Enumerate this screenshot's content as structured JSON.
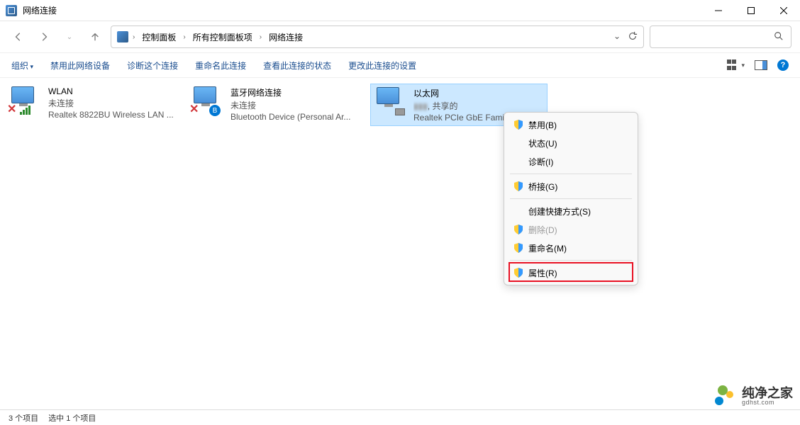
{
  "window": {
    "title": "网络连接"
  },
  "breadcrumb": {
    "root": "控制面板",
    "mid": "所有控制面板项",
    "leaf": "网络连接"
  },
  "toolbar": {
    "organize": "组织",
    "disable": "禁用此网络设备",
    "diagnose": "诊断这个连接",
    "rename": "重命名此连接",
    "status": "查看此连接的状态",
    "settings": "更改此连接的设置"
  },
  "connections": [
    {
      "name": "WLAN",
      "status": "未连接",
      "device": "Realtek 8822BU Wireless LAN ..."
    },
    {
      "name": "蓝牙网络连接",
      "status": "未连接",
      "device": "Bluetooth Device (Personal Ar..."
    },
    {
      "name": "以太网",
      "status_extra": ", 共享的",
      "device": "Realtek PCIe GbE Famil..."
    }
  ],
  "context_menu": {
    "disable": "禁用(B)",
    "status": "状态(U)",
    "diagnose": "诊断(I)",
    "bridge": "桥接(G)",
    "shortcut": "创建快捷方式(S)",
    "delete": "删除(D)",
    "rename": "重命名(M)",
    "properties": "属性(R)"
  },
  "statusbar": {
    "count": "3 个项目",
    "selected": "选中 1 个项目"
  },
  "watermark": {
    "zh": "纯净之家",
    "en": "gdhst.com"
  }
}
